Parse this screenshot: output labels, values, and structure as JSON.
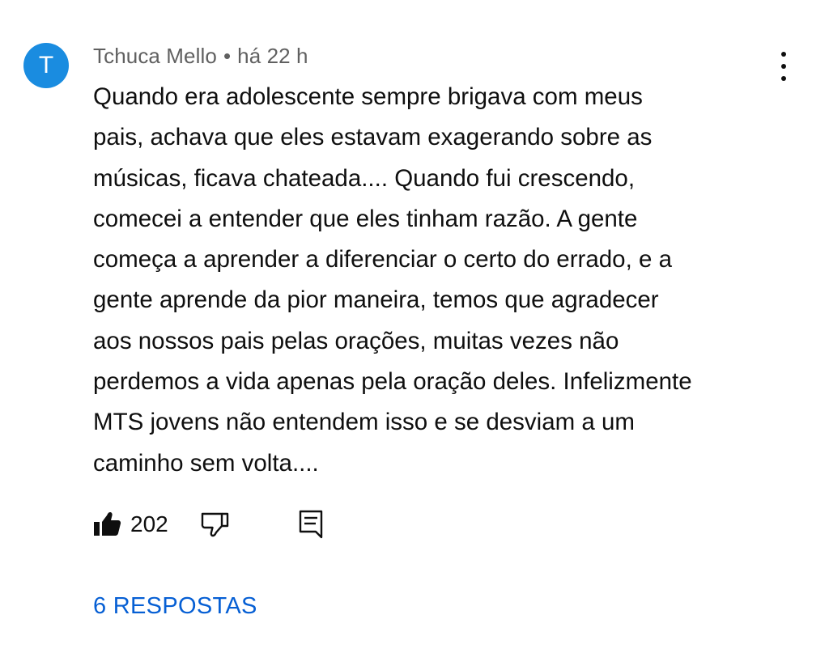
{
  "comment": {
    "avatar_letter": "T",
    "avatar_color": "#1a8ce0",
    "author": "Tchuca Mello",
    "separator": "•",
    "time": "há 22 h",
    "text_lines": [
      "Quando era adolescente sempre brigava com meus",
      "pais, achava que eles estavam exagerando sobre as",
      "músicas, ficava chateada.... Quando fui crescendo,",
      "comecei a entender que eles tinham razão. A gente",
      "começa a aprender a diferenciar o certo do errado, e a",
      "gente aprende da pior maneira, temos que agradecer",
      "aos nossos pais pelas orações, muitas vezes não",
      "perdemos a vida apenas pela oração deles. Infelizmente",
      "MTS jovens não entendem isso e se desviam a um",
      "caminho sem volta...."
    ],
    "like_count": "202",
    "replies_label": "6 RESPOSTAS",
    "accent_color": "#065fd4",
    "icons": {
      "like": "thumbs-up-filled-icon",
      "dislike": "thumbs-down-outline-icon",
      "reply": "comment-reply-icon",
      "menu": "more-vertical-icon"
    }
  }
}
